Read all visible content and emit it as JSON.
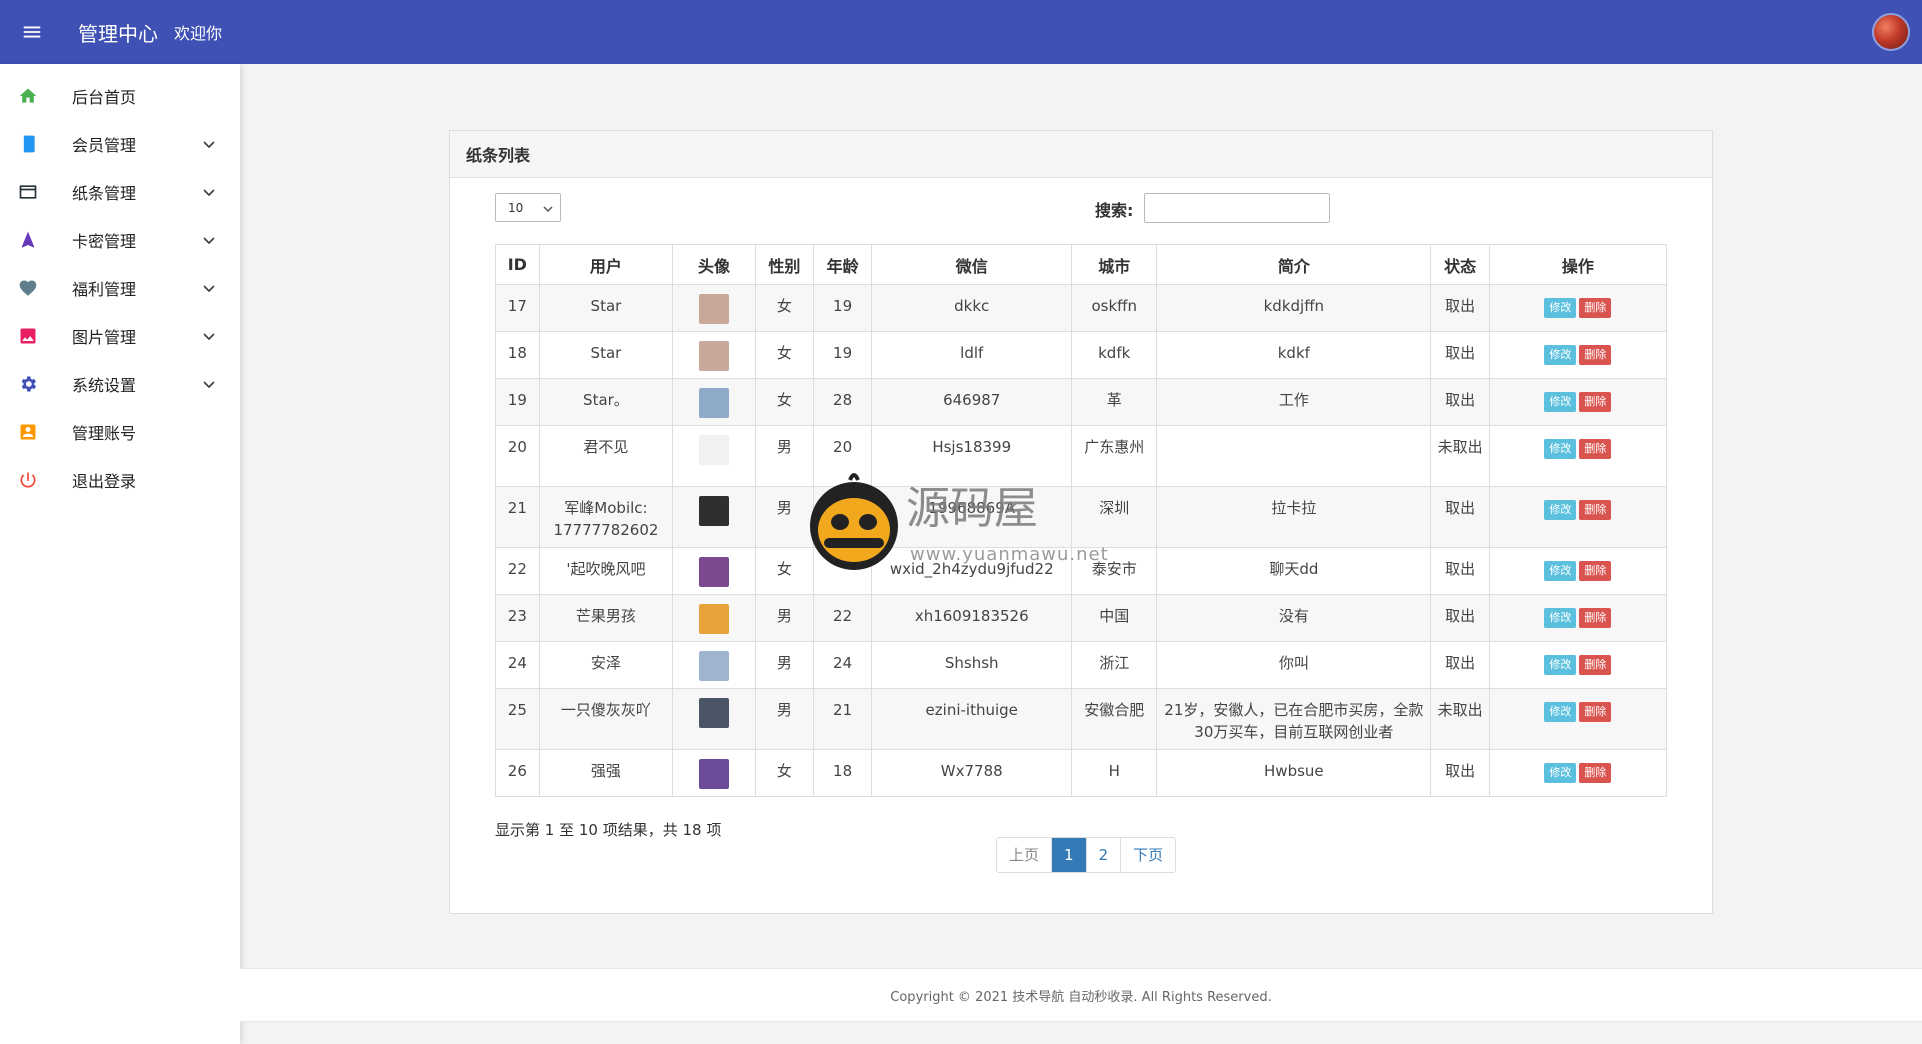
{
  "header": {
    "title": "管理中心",
    "welcome": "欢迎你"
  },
  "sidebar": {
    "items": [
      {
        "label": "后台首页",
        "icon": "home-icon",
        "color": "#4caf50",
        "has_sub": false
      },
      {
        "label": "会员管理",
        "icon": "book-icon",
        "color": "#2196f3",
        "has_sub": true
      },
      {
        "label": "纸条管理",
        "icon": "card-icon",
        "color": "#263238",
        "has_sub": true
      },
      {
        "label": "卡密管理",
        "icon": "navigation-icon",
        "color": "#673ab7",
        "has_sub": true
      },
      {
        "label": "福利管理",
        "icon": "heart-icon",
        "color": "#607d8b",
        "has_sub": true
      },
      {
        "label": "图片管理",
        "icon": "image-icon",
        "color": "#e91e63",
        "has_sub": true
      },
      {
        "label": "系统设置",
        "icon": "gear-icon",
        "color": "#3f51b5",
        "has_sub": true
      },
      {
        "label": "管理账号",
        "icon": "account-box-icon",
        "color": "#ff9800",
        "has_sub": false
      },
      {
        "label": "退出登录",
        "icon": "power-icon",
        "color": "#f44336",
        "has_sub": false
      }
    ]
  },
  "panel": {
    "title": "纸条列表",
    "page_length": "10",
    "search_label": "搜索:",
    "search_value": ""
  },
  "table": {
    "columns": [
      "ID",
      "用户",
      "头像",
      "性别",
      "年龄",
      "微信",
      "城市",
      "简介",
      "状态",
      "操作"
    ],
    "edit_label": "修改",
    "delete_label": "删除",
    "rows": [
      {
        "id": "17",
        "user": "Star",
        "avatar_color": "#c9a89a",
        "gender": "女",
        "age": "19",
        "wechat": "dkkc",
        "city": "oskffn",
        "intro": "kdkdjffn",
        "status": "取出"
      },
      {
        "id": "18",
        "user": "Star",
        "avatar_color": "#c9a89a",
        "gender": "女",
        "age": "19",
        "wechat": "ldlf",
        "city": "kdfk",
        "intro": "kdkf",
        "status": "取出"
      },
      {
        "id": "19",
        "user": "Star。",
        "avatar_color": "#8fa9c8",
        "gender": "女",
        "age": "28",
        "wechat": "646987",
        "city": "革",
        "intro": "工作",
        "status": "取出"
      },
      {
        "id": "20",
        "user": "君不见",
        "avatar_color": "#f1f1f1",
        "gender": "男",
        "age": "20",
        "wechat": "Hsjs18399",
        "city": "广东惠州",
        "intro": "",
        "status": "未取出"
      },
      {
        "id": "21",
        "user": "军峰Mobilc: 17777782602",
        "avatar_color": "#2f2f2f",
        "gender": "男",
        "age": "",
        "wechat": "19968869A",
        "city": "深圳",
        "intro": "拉卡拉",
        "status": "取出"
      },
      {
        "id": "22",
        "user": "'起吹晚风吧",
        "avatar_color": "#7b4a8f",
        "gender": "女",
        "age": "",
        "wechat": "wxid_2h4zydu9jfud22",
        "city": "泰安市",
        "intro": "聊天dd",
        "status": "取出"
      },
      {
        "id": "23",
        "user": "芒果男孩",
        "avatar_color": "#e8a33a",
        "gender": "男",
        "age": "22",
        "wechat": "xh1609183526",
        "city": "中国",
        "intro": "没有",
        "status": "取出"
      },
      {
        "id": "24",
        "user": "安泽",
        "avatar_color": "#9fb4d0",
        "gender": "男",
        "age": "24",
        "wechat": "Shshsh",
        "city": "浙江",
        "intro": "你叫",
        "status": "取出"
      },
      {
        "id": "25",
        "user": "一只傻灰灰吖",
        "avatar_color": "#4a5566",
        "gender": "男",
        "age": "21",
        "wechat": "ezini-ithuige",
        "city": "安徽合肥",
        "intro": "21岁，安徽人，已在合肥市买房，全款30万买车，目前互联网创业者",
        "status": "未取出"
      },
      {
        "id": "26",
        "user": "强强",
        "avatar_color": "#6b4c9a",
        "gender": "女",
        "age": "18",
        "wechat": "Wx7788",
        "city": "H",
        "intro": "Hwbsue",
        "status": "取出"
      }
    ]
  },
  "pagination": {
    "info": "显示第 1 至 10 项结果，共 18 项",
    "prev": "上页",
    "pages": [
      "1",
      "2"
    ],
    "active_page": "1",
    "next": "下页"
  },
  "footer": {
    "text": "Copyright © 2021 技术导航 自动秒收录. All Rights Reserved."
  },
  "watermark": {
    "title": "源码屋",
    "url": "www.yuanmawu.net"
  },
  "colors": {
    "header_bg": "#3f51b5",
    "edit_btn": "#5bc0de",
    "delete_btn": "#d9534f",
    "active_page": "#337ab7"
  }
}
